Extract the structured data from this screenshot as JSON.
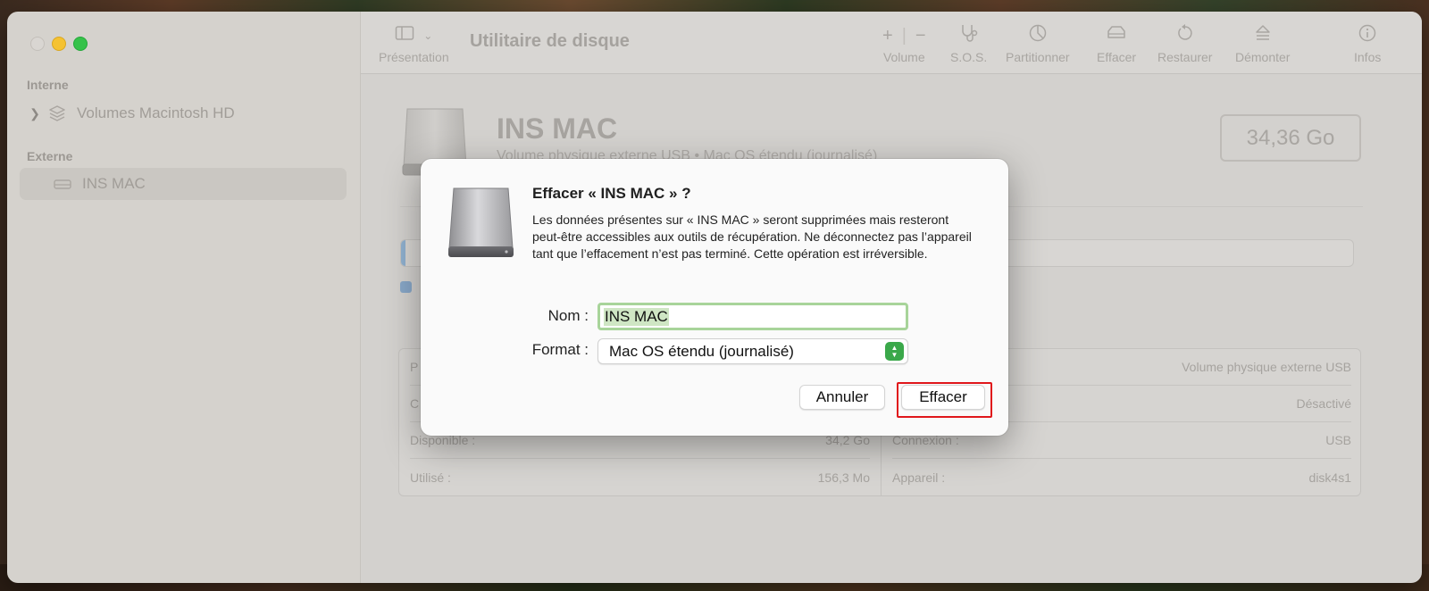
{
  "window": {
    "title": "Utilitaire de disque"
  },
  "toolbar": {
    "view_label": "Présentation",
    "volume_label": "Volume",
    "sos_label": "S.O.S.",
    "partition_label": "Partitionner",
    "erase_label": "Effacer",
    "restore_label": "Restaurer",
    "unmount_label": "Démonter",
    "info_label": "Infos"
  },
  "sidebar": {
    "section_internal": "Interne",
    "internal_item": "Volumes Macintosh HD",
    "section_external": "Externe",
    "external_item": "INS MAC"
  },
  "disk": {
    "name": "INS MAC",
    "subtitle": "Volume physique externe USB • Mac OS étendu (journalisé)",
    "capacity": "34,36 Go",
    "used_fraction": 0.0045
  },
  "info_table": {
    "left": [
      {
        "label": "P",
        "value": ""
      },
      {
        "label": "C",
        "value": ""
      },
      {
        "label": "Disponible :",
        "value": "34,2 Go"
      },
      {
        "label": "Utilisé :",
        "value": "156,3 Mo"
      }
    ],
    "right": [
      {
        "label": "",
        "value": "Volume physique externe USB"
      },
      {
        "label": "",
        "value": "Désactivé"
      },
      {
        "label": "Connexion :",
        "value": "USB"
      },
      {
        "label": "Appareil :",
        "value": "disk4s1"
      }
    ]
  },
  "dialog": {
    "title": "Effacer « INS MAC » ?",
    "body": "Les données présentes sur « INS MAC » seront supprimées mais resteront peut-être accessibles aux outils de récupération. Ne déconnectez pas l’appareil tant que l’effacement n’est pas terminé. Cette opération est irréversible.",
    "name_label": "Nom :",
    "name_value": "INS MAC",
    "format_label": "Format :",
    "format_value": "Mac OS étendu (journalisé)",
    "cancel_label": "Annuler",
    "erase_label": "Effacer"
  },
  "colors": {
    "highlight": "#e0171b",
    "selection": "#a8d49a",
    "stepper": "#3aa84a"
  }
}
